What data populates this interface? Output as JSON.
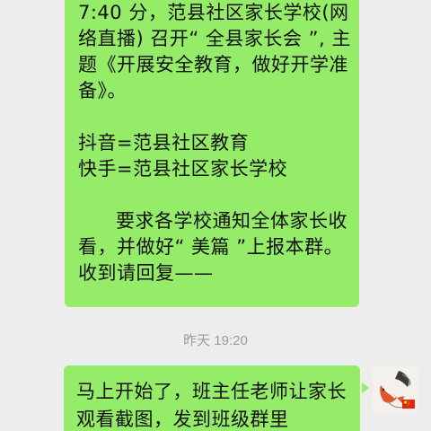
{
  "messages": {
    "first": {
      "lines": [
        "7:40 分，范县社区家长学校(网",
        "络直播) 召开“ 全县家长会 ”, 主",
        "题《开展安全教育，做好开学准",
        "备》。",
        "抖音=范县社区教育",
        "快手=范县社区家长学校",
        "要求各学校通知全体家长收",
        "看，并做好“ 美篇 ”上报本群。",
        "收到请回复——"
      ]
    },
    "timestamp": "昨天 19:20",
    "second": {
      "lines": [
        "马上开始了，班主任老师让家长",
        "观看截图，发到班级群里"
      ]
    }
  },
  "colors": {
    "bubble": "#95ec69",
    "background": "#ededed",
    "timestamp": "#9b9b9b"
  },
  "icons": {
    "avatar": "koi-fish-avatar",
    "flag": "china-flag-icon"
  }
}
